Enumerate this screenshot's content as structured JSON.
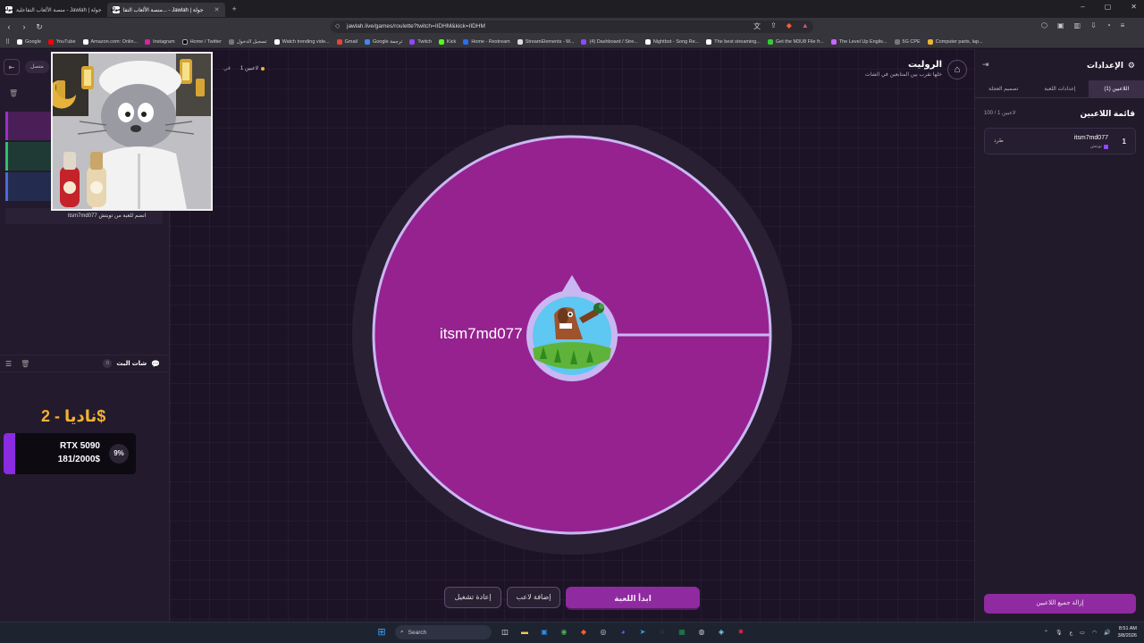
{
  "browser": {
    "tabs": [
      {
        "favicon": "جولة",
        "title": "منصة الألعاب التفاعلية - Jawlah | جولة",
        "active": false
      },
      {
        "favicon": "جولة",
        "title": "منصة الألعاب التفا... - Jawlah | جولة",
        "active": true
      }
    ],
    "url": "jawlah.live/games/roulette?twitch=IIDHM&kick=IIDHM",
    "bookmarks": [
      "Google",
      "YouTube",
      "Amazon.com: Onlin...",
      "Instagram",
      "Home / Twitter",
      "تسجيل الدخول",
      "Watch trending vide...",
      "Gmail",
      "Google ترجمة",
      "Twitch",
      "Kick",
      "Home - Restream",
      "StreamElements - M...",
      "(4) Dashboard / Stre...",
      "Nightbot - Song Re...",
      "The best streaming...",
      "Get the M3U8 File fr...",
      "The Level Up Englis...",
      "5G CPE",
      "Computer parts, lap..."
    ]
  },
  "left_panel": {
    "connect_label": "متصل",
    "join_message": "itsm7md077 انضم للعبة من تويتش",
    "chat_title": "شات البث",
    "chat_count": "0",
    "donation": {
      "donor": "ناديا - 2$",
      "item": "RTX 5090",
      "progress_text": "181/2000$",
      "percent_label": "9%",
      "fraction": 0.09
    }
  },
  "header": {
    "title": "الروليت",
    "subtitle": "خلها تقرب بين المتابعين في الشات",
    "players_count": "1 لاعبين",
    "partial_label": "في"
  },
  "wheel": {
    "segments": [
      {
        "label": "itsm7md077",
        "color": "#962290"
      }
    ]
  },
  "buttons": {
    "start": "ابدأ اللعبة",
    "add_player": "إضافة لاعب",
    "restart": "إعادة تشغيل"
  },
  "right_panel": {
    "title": "الإعدادات",
    "tabs": [
      "اللاعبين (1)",
      "إعدادات اللعبة",
      "تصميم العجلة"
    ],
    "list_title": "قائمة اللاعبين",
    "list_count": "100 / 1 لاعبين",
    "players": [
      {
        "index": "1",
        "name": "itsm7md077",
        "source": "تويتش",
        "kick_label": "طرد"
      }
    ],
    "remove_all": "إزالة جميع اللاعبين"
  },
  "taskbar": {
    "search_placeholder": "Search",
    "time": "8:51 AM",
    "date": "3/8/2026"
  },
  "colors": {
    "accent": "#8f2aa0",
    "wheel_segment": "#962290",
    "wheel_border": "#c9b7f2",
    "gold": "#f2b233"
  }
}
